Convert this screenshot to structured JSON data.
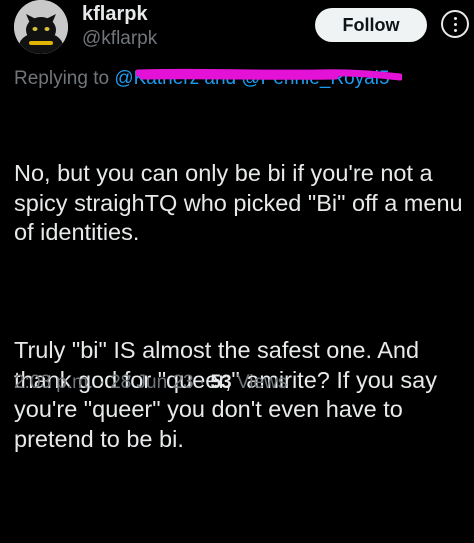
{
  "author": {
    "display_name": "kflarpk",
    "handle": "@kflarpk",
    "avatar_icon": "black-cat-avatar-icon"
  },
  "actions": {
    "follow_label": "Follow",
    "more_icon": "more-options-icon"
  },
  "reply_context": {
    "prefix": "Replying to",
    "mentions": "@Katherz and @Pennie_Royal5"
  },
  "tweet": {
    "paragraphs": [
      "No, but you can only be bi if you're not a spicy straighTQ who picked \"Bi\" off a menu of identities.",
      "Truly \"bi\" IS almost the safest one. And thank god for \"queer,\" amirite? If you say you're \"queer\" you don't even have to pretend to be bi."
    ]
  },
  "meta": {
    "time": "2:03 p.m.",
    "separator": "·",
    "date": "28 Jun 23",
    "views_count": "53",
    "views_label": "Views"
  },
  "colors": {
    "background": "#000000",
    "text": "#e7e9ea",
    "muted": "#71767b",
    "link": "#1d9bf0",
    "redaction": "#e412d6"
  }
}
